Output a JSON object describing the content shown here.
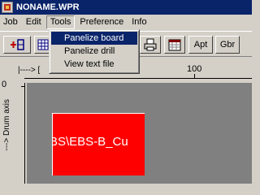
{
  "window": {
    "title": "NONAME.WPR"
  },
  "menubar": {
    "items": [
      {
        "label": "Job"
      },
      {
        "label": "Edit"
      },
      {
        "label": "Tools"
      },
      {
        "label": "Preference"
      },
      {
        "label": "Info"
      }
    ]
  },
  "tools_menu": {
    "items": [
      {
        "label": "Panelize board",
        "selected": true
      },
      {
        "label": "Panelize drill",
        "selected": false
      },
      {
        "label": "View text file",
        "selected": false
      }
    ]
  },
  "toolbar": {
    "apt_label": "Apt",
    "gbr_label": "Gbr"
  },
  "ruler": {
    "axis_label": "|----> [",
    "tick_label_100": "100",
    "vertical_zero": "0",
    "vertical_axis_label": "---> Drum axis"
  },
  "canvas": {
    "board_text": "BS\\EBS-B_Cu",
    "board_color": "#ff0000",
    "background_color": "#808080"
  },
  "colors": {
    "title_bar": "#0a246a",
    "menu_highlight": "#0a246a"
  }
}
